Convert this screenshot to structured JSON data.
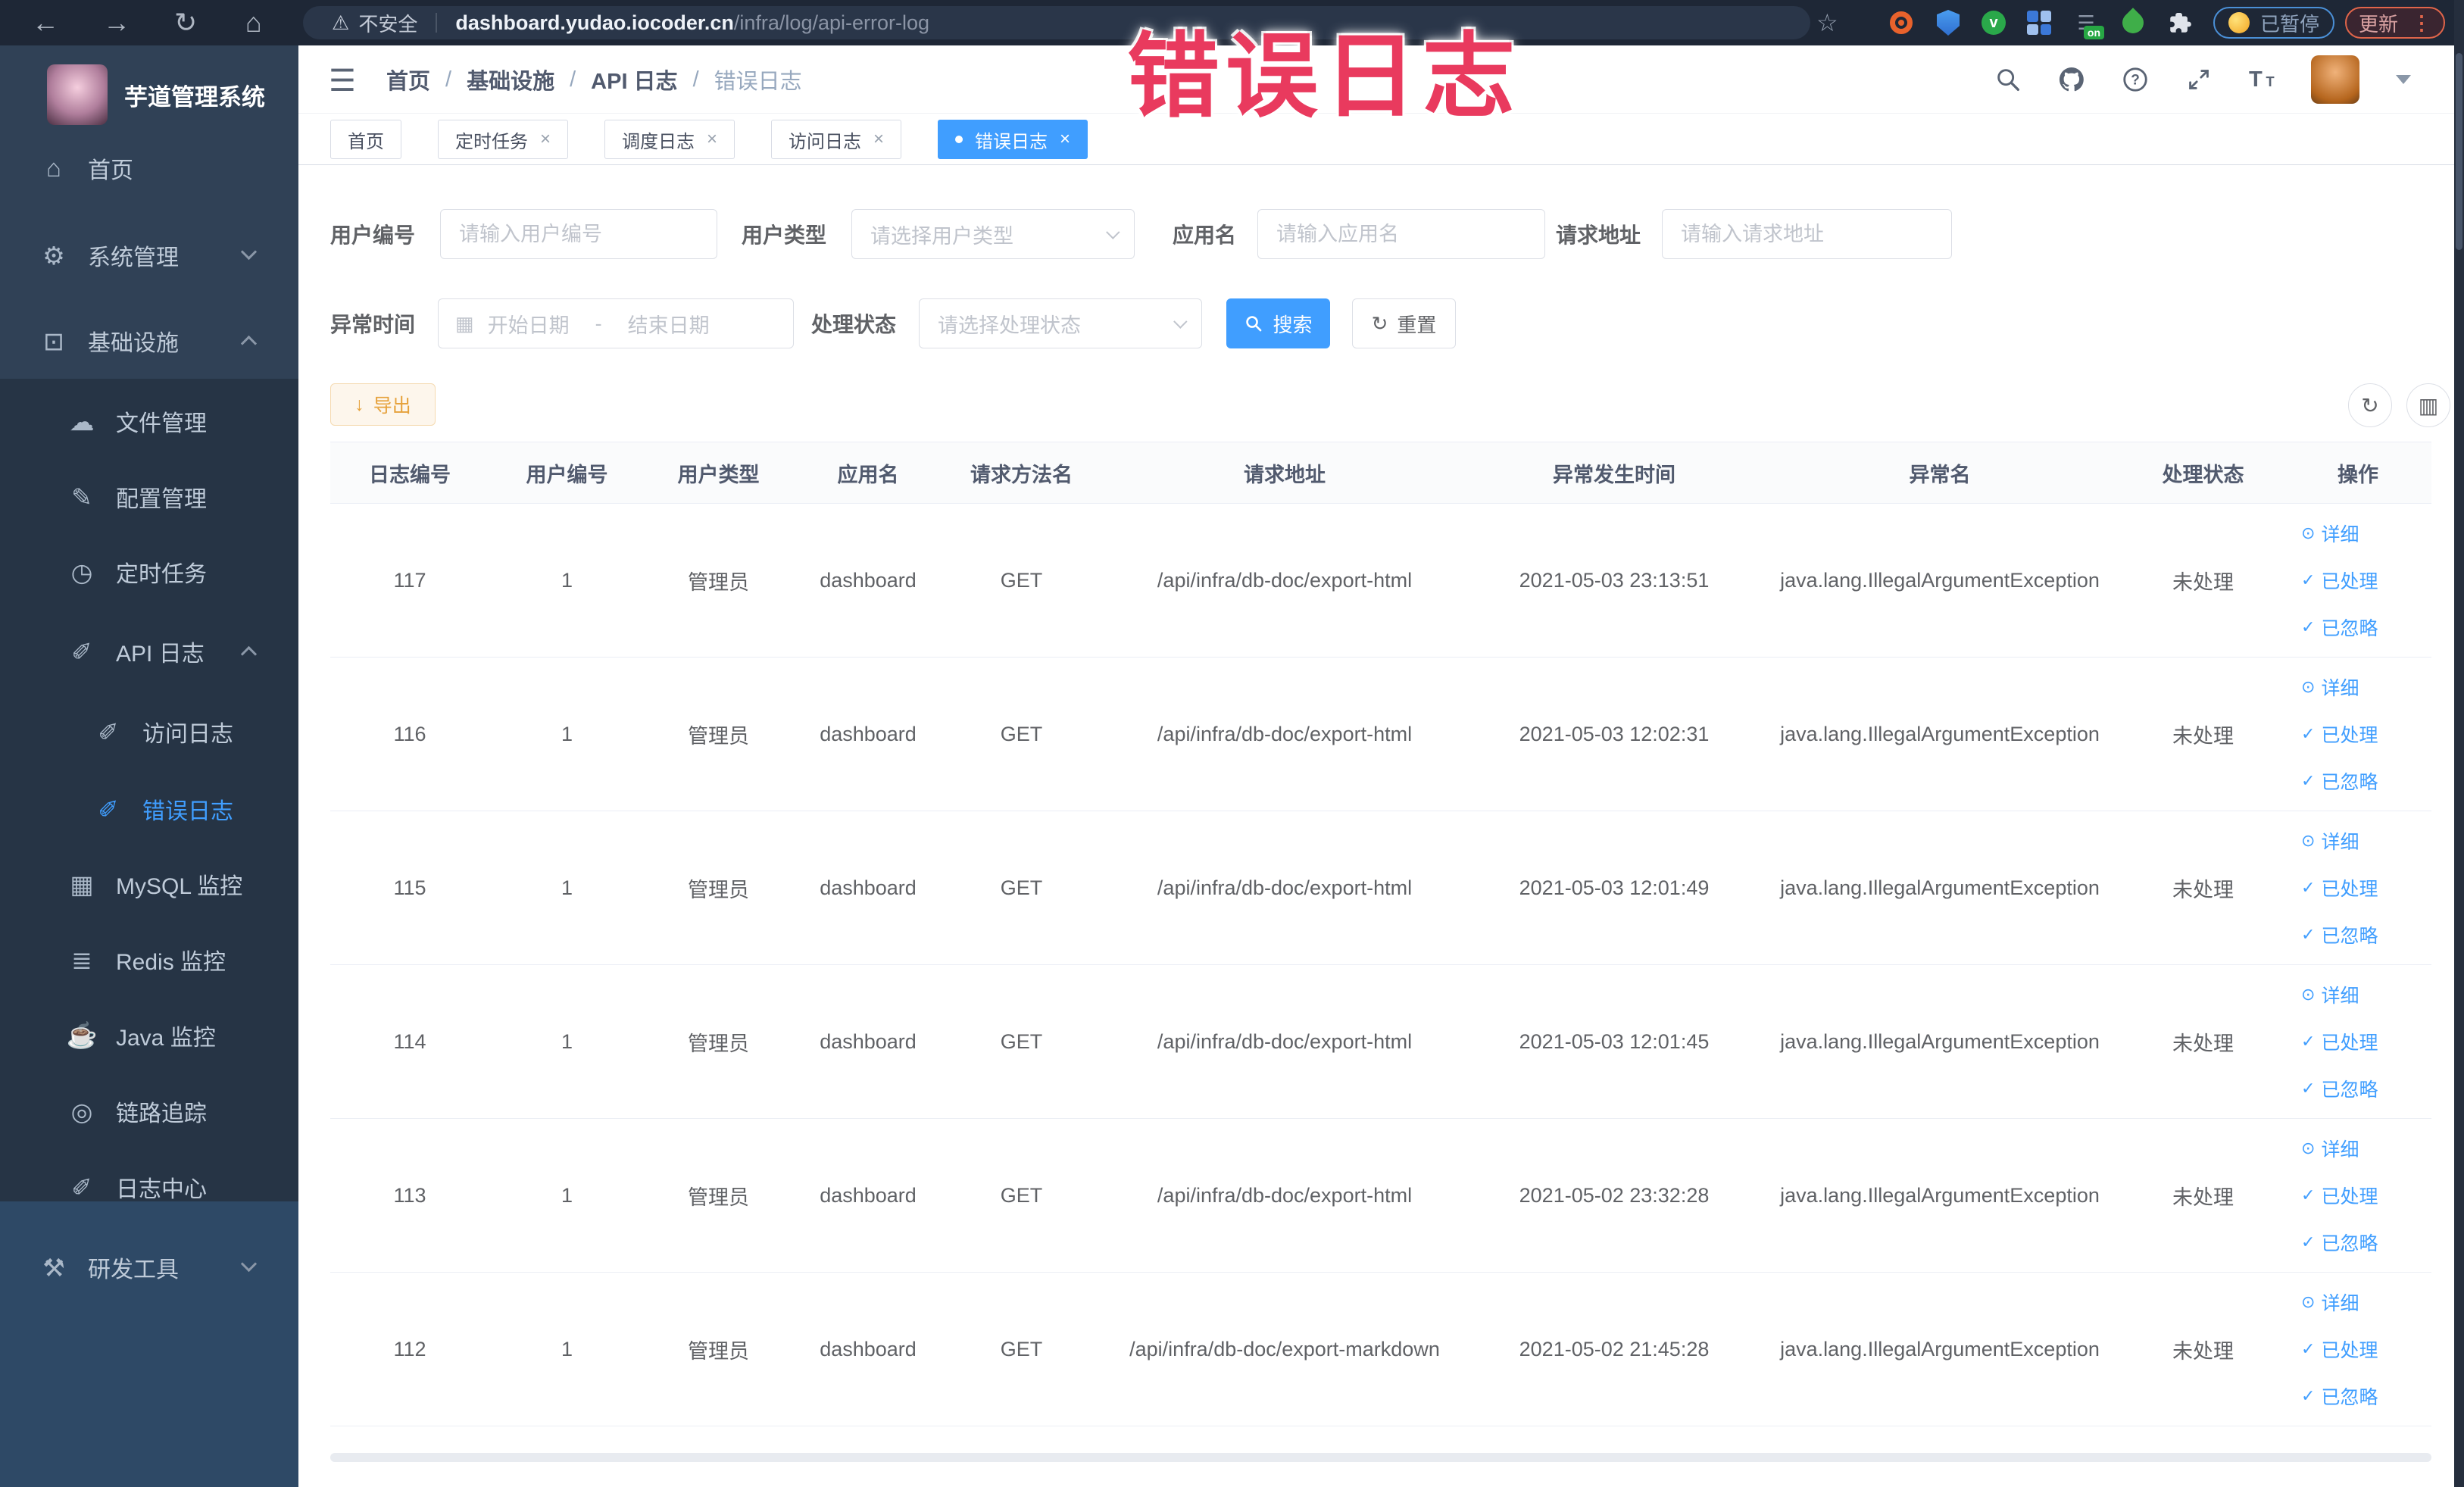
{
  "overlay": {
    "text": "错误日志",
    "color": "#e93a5e"
  },
  "browser": {
    "security_label": "不安全",
    "url_domain": "dashboard.yudao.iocoder.cn",
    "url_path": "/infra/log/api-error-log",
    "extension_on_label": "on",
    "paused_badge": "已暂停",
    "update_button": "更新"
  },
  "glyphs": {
    "back": "←",
    "forward": "→",
    "reload": "↻",
    "home": "⌂",
    "warning": "⚠",
    "star": "☆",
    "dots": "⋮",
    "hamburger": "☰",
    "calendar": "▦",
    "reset": "↻",
    "export": "↓",
    "refresh": "↻",
    "columns": "▥",
    "detail": "⊙",
    "check": "✓"
  },
  "sidebar": {
    "title": "芋道管理系统",
    "items": [
      {
        "label": "首页",
        "glyph": "⌂"
      },
      {
        "label": "系统管理",
        "glyph": "⚙"
      },
      {
        "label": "基础设施",
        "glyph": "⊡"
      },
      {
        "label": "文件管理",
        "glyph": "☁"
      },
      {
        "label": "配置管理",
        "glyph": "✎"
      },
      {
        "label": "定时任务",
        "glyph": "◷"
      },
      {
        "label": "API 日志",
        "glyph": "✐"
      },
      {
        "label": "访问日志",
        "glyph": "✐"
      },
      {
        "label": "错误日志",
        "glyph": "✐"
      },
      {
        "label": "MySQL 监控",
        "glyph": "▦"
      },
      {
        "label": "Redis 监控",
        "glyph": "≣"
      },
      {
        "label": "Java 监控",
        "glyph": "☕"
      },
      {
        "label": "链路追踪",
        "glyph": "◎"
      },
      {
        "label": "日志中心",
        "glyph": "✐"
      },
      {
        "label": "研发工具",
        "glyph": "⚒"
      }
    ]
  },
  "header": {
    "breadcrumb": [
      "首页",
      "基础设施",
      "API 日志",
      "错误日志"
    ],
    "separator": "/"
  },
  "tabs": [
    {
      "label": "首页"
    },
    {
      "label": "定时任务"
    },
    {
      "label": "调度日志"
    },
    {
      "label": "访问日志"
    },
    {
      "label": "错误日志"
    }
  ],
  "filters": {
    "user_id": {
      "label": "用户编号",
      "placeholder": "请输入用户编号"
    },
    "user_type": {
      "label": "用户类型",
      "placeholder": "请选择用户类型"
    },
    "app_name": {
      "label": "应用名",
      "placeholder": "请输入应用名"
    },
    "request_url": {
      "label": "请求地址",
      "placeholder": "请输入请求地址"
    },
    "exception_time": {
      "label": "异常时间",
      "start_placeholder": "开始日期",
      "separator": "-",
      "end_placeholder": "结束日期"
    },
    "process_status": {
      "label": "处理状态",
      "placeholder": "请选择处理状态"
    },
    "search_button": "搜索",
    "reset_button": "重置"
  },
  "toolbar": {
    "export_button": "导出"
  },
  "table": {
    "columns": [
      "日志编号",
      "用户编号",
      "用户类型",
      "应用名",
      "请求方法名",
      "请求地址",
      "异常发生时间",
      "异常名",
      "处理状态",
      "操作"
    ],
    "actions": [
      "详细",
      "已处理",
      "已忽略"
    ],
    "rows": [
      {
        "id": "117",
        "user_id": "1",
        "user_type": "管理员",
        "app_name": "dashboard",
        "method": "GET",
        "url": "/api/infra/db-doc/export-html",
        "time": "2021-05-03 23:13:51",
        "exception": "java.lang.IllegalArgumentException",
        "status": "未处理"
      },
      {
        "id": "116",
        "user_id": "1",
        "user_type": "管理员",
        "app_name": "dashboard",
        "method": "GET",
        "url": "/api/infra/db-doc/export-html",
        "time": "2021-05-03 12:02:31",
        "exception": "java.lang.IllegalArgumentException",
        "status": "未处理"
      },
      {
        "id": "115",
        "user_id": "1",
        "user_type": "管理员",
        "app_name": "dashboard",
        "method": "GET",
        "url": "/api/infra/db-doc/export-html",
        "time": "2021-05-03 12:01:49",
        "exception": "java.lang.IllegalArgumentException",
        "status": "未处理"
      },
      {
        "id": "114",
        "user_id": "1",
        "user_type": "管理员",
        "app_name": "dashboard",
        "method": "GET",
        "url": "/api/infra/db-doc/export-html",
        "time": "2021-05-03 12:01:45",
        "exception": "java.lang.IllegalArgumentException",
        "status": "未处理"
      },
      {
        "id": "113",
        "user_id": "1",
        "user_type": "管理员",
        "app_name": "dashboard",
        "method": "GET",
        "url": "/api/infra/db-doc/export-html",
        "time": "2021-05-02 23:32:28",
        "exception": "java.lang.IllegalArgumentException",
        "status": "未处理"
      },
      {
        "id": "112",
        "user_id": "1",
        "user_type": "管理员",
        "app_name": "dashboard",
        "method": "GET",
        "url": "/api/infra/db-doc/export-markdown",
        "time": "2021-05-02 21:45:28",
        "exception": "java.lang.IllegalArgumentException",
        "status": "未处理"
      }
    ]
  }
}
